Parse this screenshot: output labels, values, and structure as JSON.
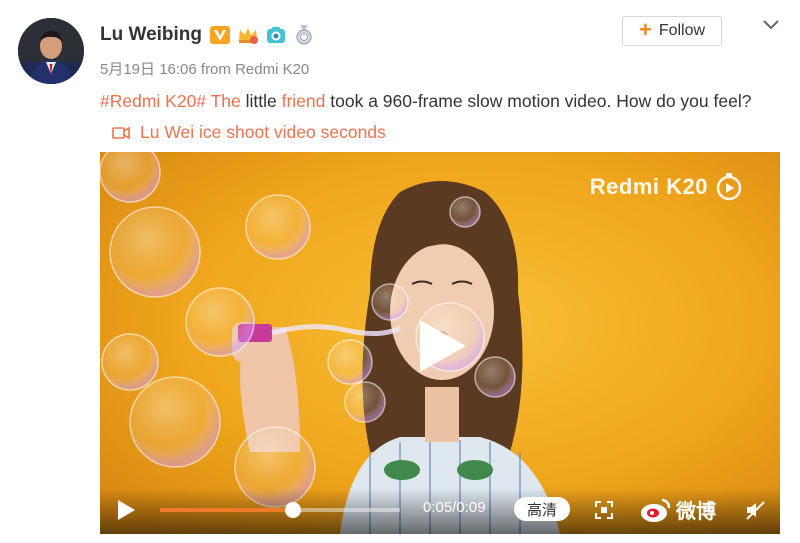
{
  "post": {
    "author": "Lu Weibing",
    "meta": "5月19日 16:06 from Redmi K20",
    "follow_label": "Follow",
    "text": {
      "hashtag": "#Redmi K20#",
      "the": "The",
      "little": " little ",
      "friend": "friend",
      "rest": " took a 960-frame slow motion video. How do you feel?",
      "video_link": "Lu Wei ice shoot video seconds"
    }
  },
  "badges": [
    "verified-v-badge",
    "crown-badge",
    "camera-badge",
    "medal-badge"
  ],
  "video": {
    "watermark": "Redmi K20",
    "time": "0:05/0:09",
    "progress": 0.5556,
    "quality_label": "高清",
    "brand": "微博"
  },
  "colors": {
    "link": "#eb7350",
    "follow_plus": "#f28a28",
    "video_bg": "#f0a61c",
    "progress": "#f07c2a"
  }
}
